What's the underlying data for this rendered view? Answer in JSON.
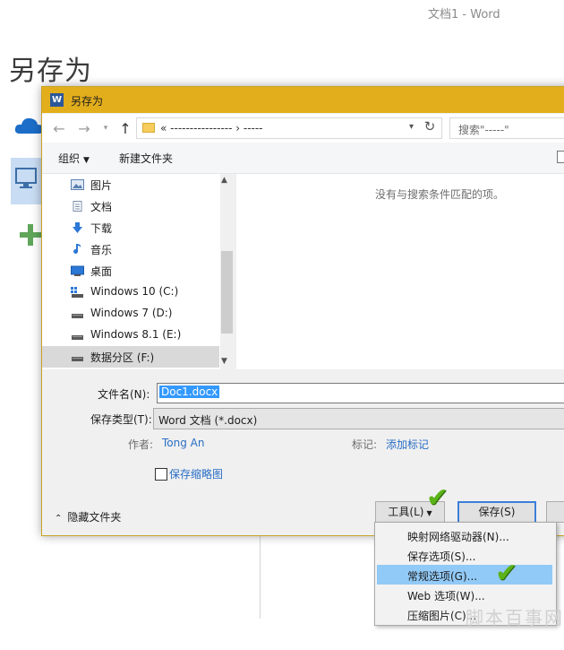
{
  "app": {
    "window_title": "文档1 - Word",
    "backstage_heading": "另存为"
  },
  "dialog": {
    "title": "另存为",
    "word_icon_letter": "W",
    "address_path": "« ---------------- › -----",
    "search_placeholder": "搜索\"-----\"",
    "toolbar": {
      "organize": "组织",
      "new_folder": "新建文件夹"
    },
    "nav_items": [
      {
        "label": "图片",
        "icon": "pictures-icon"
      },
      {
        "label": "文档",
        "icon": "documents-icon"
      },
      {
        "label": "下载",
        "icon": "downloads-icon"
      },
      {
        "label": "音乐",
        "icon": "music-icon"
      },
      {
        "label": "桌面",
        "icon": "desktop-icon"
      },
      {
        "label": "Windows 10 (C:)",
        "icon": "windows-drive-icon"
      },
      {
        "label": "Windows 7 (D:)",
        "icon": "drive-icon"
      },
      {
        "label": "Windows 8.1 (E:)",
        "icon": "drive-icon"
      },
      {
        "label": "数据分区 (F:)",
        "icon": "drive-icon",
        "selected": true
      }
    ],
    "empty_message": "没有与搜索条件匹配的项。",
    "filename_label": "文件名(N):",
    "filename_value": "Doc1.docx",
    "filetype_label": "保存类型(T):",
    "filetype_value": "Word 文档 (*.docx)",
    "author_label": "作者:",
    "author_value": "Tong An",
    "tags_label": "标记:",
    "tags_value": "添加标记",
    "thumbnail_label": "保存缩略图",
    "hide_folders_label": "隐藏文件夹",
    "tools_button": "工具(L)",
    "save_button": "保存(S)"
  },
  "tools_menu": {
    "items": [
      {
        "label": "映射网络驱动器(N)..."
      },
      {
        "label": "保存选项(S)..."
      },
      {
        "label": "常规选项(G)...",
        "highlighted": true
      },
      {
        "label": "Web 选项(W)..."
      },
      {
        "label": "压缩图片(C)..."
      }
    ]
  },
  "watermark": "脚本百事网",
  "colors": {
    "dialog_titlebar": "#e3ae1c",
    "selection": "#3399ff",
    "menu_highlight": "#91c9f7",
    "link": "#2a6ec5",
    "check_mark": "#5bb318"
  }
}
